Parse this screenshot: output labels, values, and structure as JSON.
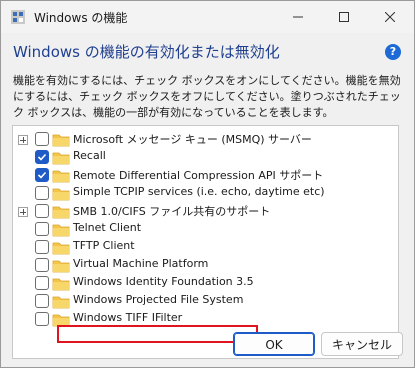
{
  "window": {
    "title": "Windows の機能"
  },
  "colors": {
    "accent": "#1f5bc6",
    "heading": "#1f3f8f",
    "highlight_box": "#e0141e",
    "folder": "#f3c64b"
  },
  "heading": "Windows の機能の有効化または無効化",
  "help_icon": "?",
  "description": "機能を有効にするには、チェック ボックスをオンにしてください。機能を無効にするには、チェック ボックスをオフにしてください。塗りつぶされたチェック ボックスは、機能の一部が有効になっていることを表します。",
  "features": [
    {
      "label": "Microsoft メッセージ キュー (MSMQ) サーバー",
      "checked": false,
      "expandable": true
    },
    {
      "label": "Recall",
      "checked": true,
      "expandable": false
    },
    {
      "label": "Remote Differential Compression API サポート",
      "checked": true,
      "expandable": false
    },
    {
      "label": "Simple TCPIP services (i.e. echo, daytime etc)",
      "checked": false,
      "expandable": false
    },
    {
      "label": "SMB 1.0/CIFS ファイル共有のサポート",
      "checked": false,
      "expandable": true,
      "highlighted": true
    },
    {
      "label": "Telnet Client",
      "checked": false,
      "expandable": false
    },
    {
      "label": "TFTP Client",
      "checked": false,
      "expandable": false
    },
    {
      "label": "Virtual Machine Platform",
      "checked": false,
      "expandable": false
    },
    {
      "label": "Windows Identity Foundation 3.5",
      "checked": false,
      "expandable": false
    },
    {
      "label": "Windows Projected File System",
      "checked": false,
      "expandable": false
    },
    {
      "label": "Windows TIFF IFilter",
      "checked": false,
      "expandable": false
    }
  ],
  "buttons": {
    "ok": "OK",
    "cancel": "キャンセル"
  }
}
